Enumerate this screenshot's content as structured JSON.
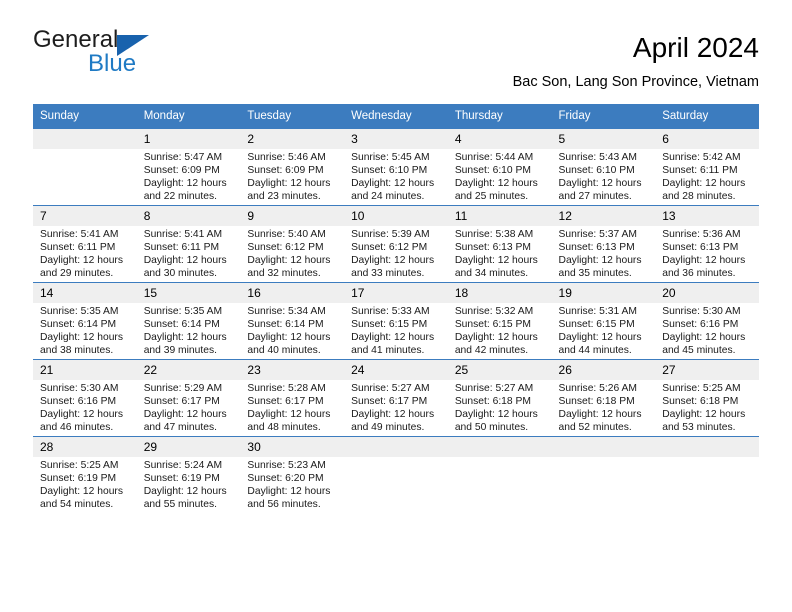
{
  "brand": {
    "name_part1": "General",
    "name_part2": "Blue",
    "colors": {
      "dark": "#1d1d1d",
      "blue": "#1f7ac4",
      "triangle": "#1862ad"
    }
  },
  "header": {
    "title": "April 2024",
    "subtitle": "Bac Son, Lang Son Province, Vietnam"
  },
  "calendar": {
    "header_color": "#3c7cbf",
    "daynum_bg": "#efefef",
    "weekdays": [
      "Sunday",
      "Monday",
      "Tuesday",
      "Wednesday",
      "Thursday",
      "Friday",
      "Saturday"
    ],
    "weeks": [
      [
        {
          "day": "",
          "lines": []
        },
        {
          "day": "1",
          "lines": [
            "Sunrise: 5:47 AM",
            "Sunset: 6:09 PM",
            "Daylight: 12 hours",
            "and 22 minutes."
          ]
        },
        {
          "day": "2",
          "lines": [
            "Sunrise: 5:46 AM",
            "Sunset: 6:09 PM",
            "Daylight: 12 hours",
            "and 23 minutes."
          ]
        },
        {
          "day": "3",
          "lines": [
            "Sunrise: 5:45 AM",
            "Sunset: 6:10 PM",
            "Daylight: 12 hours",
            "and 24 minutes."
          ]
        },
        {
          "day": "4",
          "lines": [
            "Sunrise: 5:44 AM",
            "Sunset: 6:10 PM",
            "Daylight: 12 hours",
            "and 25 minutes."
          ]
        },
        {
          "day": "5",
          "lines": [
            "Sunrise: 5:43 AM",
            "Sunset: 6:10 PM",
            "Daylight: 12 hours",
            "and 27 minutes."
          ]
        },
        {
          "day": "6",
          "lines": [
            "Sunrise: 5:42 AM",
            "Sunset: 6:11 PM",
            "Daylight: 12 hours",
            "and 28 minutes."
          ]
        }
      ],
      [
        {
          "day": "7",
          "lines": [
            "Sunrise: 5:41 AM",
            "Sunset: 6:11 PM",
            "Daylight: 12 hours",
            "and 29 minutes."
          ]
        },
        {
          "day": "8",
          "lines": [
            "Sunrise: 5:41 AM",
            "Sunset: 6:11 PM",
            "Daylight: 12 hours",
            "and 30 minutes."
          ]
        },
        {
          "day": "9",
          "lines": [
            "Sunrise: 5:40 AM",
            "Sunset: 6:12 PM",
            "Daylight: 12 hours",
            "and 32 minutes."
          ]
        },
        {
          "day": "10",
          "lines": [
            "Sunrise: 5:39 AM",
            "Sunset: 6:12 PM",
            "Daylight: 12 hours",
            "and 33 minutes."
          ]
        },
        {
          "day": "11",
          "lines": [
            "Sunrise: 5:38 AM",
            "Sunset: 6:13 PM",
            "Daylight: 12 hours",
            "and 34 minutes."
          ]
        },
        {
          "day": "12",
          "lines": [
            "Sunrise: 5:37 AM",
            "Sunset: 6:13 PM",
            "Daylight: 12 hours",
            "and 35 minutes."
          ]
        },
        {
          "day": "13",
          "lines": [
            "Sunrise: 5:36 AM",
            "Sunset: 6:13 PM",
            "Daylight: 12 hours",
            "and 36 minutes."
          ]
        }
      ],
      [
        {
          "day": "14",
          "lines": [
            "Sunrise: 5:35 AM",
            "Sunset: 6:14 PM",
            "Daylight: 12 hours",
            "and 38 minutes."
          ]
        },
        {
          "day": "15",
          "lines": [
            "Sunrise: 5:35 AM",
            "Sunset: 6:14 PM",
            "Daylight: 12 hours",
            "and 39 minutes."
          ]
        },
        {
          "day": "16",
          "lines": [
            "Sunrise: 5:34 AM",
            "Sunset: 6:14 PM",
            "Daylight: 12 hours",
            "and 40 minutes."
          ]
        },
        {
          "day": "17",
          "lines": [
            "Sunrise: 5:33 AM",
            "Sunset: 6:15 PM",
            "Daylight: 12 hours",
            "and 41 minutes."
          ]
        },
        {
          "day": "18",
          "lines": [
            "Sunrise: 5:32 AM",
            "Sunset: 6:15 PM",
            "Daylight: 12 hours",
            "and 42 minutes."
          ]
        },
        {
          "day": "19",
          "lines": [
            "Sunrise: 5:31 AM",
            "Sunset: 6:15 PM",
            "Daylight: 12 hours",
            "and 44 minutes."
          ]
        },
        {
          "day": "20",
          "lines": [
            "Sunrise: 5:30 AM",
            "Sunset: 6:16 PM",
            "Daylight: 12 hours",
            "and 45 minutes."
          ]
        }
      ],
      [
        {
          "day": "21",
          "lines": [
            "Sunrise: 5:30 AM",
            "Sunset: 6:16 PM",
            "Daylight: 12 hours",
            "and 46 minutes."
          ]
        },
        {
          "day": "22",
          "lines": [
            "Sunrise: 5:29 AM",
            "Sunset: 6:17 PM",
            "Daylight: 12 hours",
            "and 47 minutes."
          ]
        },
        {
          "day": "23",
          "lines": [
            "Sunrise: 5:28 AM",
            "Sunset: 6:17 PM",
            "Daylight: 12 hours",
            "and 48 minutes."
          ]
        },
        {
          "day": "24",
          "lines": [
            "Sunrise: 5:27 AM",
            "Sunset: 6:17 PM",
            "Daylight: 12 hours",
            "and 49 minutes."
          ]
        },
        {
          "day": "25",
          "lines": [
            "Sunrise: 5:27 AM",
            "Sunset: 6:18 PM",
            "Daylight: 12 hours",
            "and 50 minutes."
          ]
        },
        {
          "day": "26",
          "lines": [
            "Sunrise: 5:26 AM",
            "Sunset: 6:18 PM",
            "Daylight: 12 hours",
            "and 52 minutes."
          ]
        },
        {
          "day": "27",
          "lines": [
            "Sunrise: 5:25 AM",
            "Sunset: 6:18 PM",
            "Daylight: 12 hours",
            "and 53 minutes."
          ]
        }
      ],
      [
        {
          "day": "28",
          "lines": [
            "Sunrise: 5:25 AM",
            "Sunset: 6:19 PM",
            "Daylight: 12 hours",
            "and 54 minutes."
          ]
        },
        {
          "day": "29",
          "lines": [
            "Sunrise: 5:24 AM",
            "Sunset: 6:19 PM",
            "Daylight: 12 hours",
            "and 55 minutes."
          ]
        },
        {
          "day": "30",
          "lines": [
            "Sunrise: 5:23 AM",
            "Sunset: 6:20 PM",
            "Daylight: 12 hours",
            "and 56 minutes."
          ]
        },
        {
          "day": "",
          "lines": []
        },
        {
          "day": "",
          "lines": []
        },
        {
          "day": "",
          "lines": []
        },
        {
          "day": "",
          "lines": []
        }
      ]
    ]
  }
}
